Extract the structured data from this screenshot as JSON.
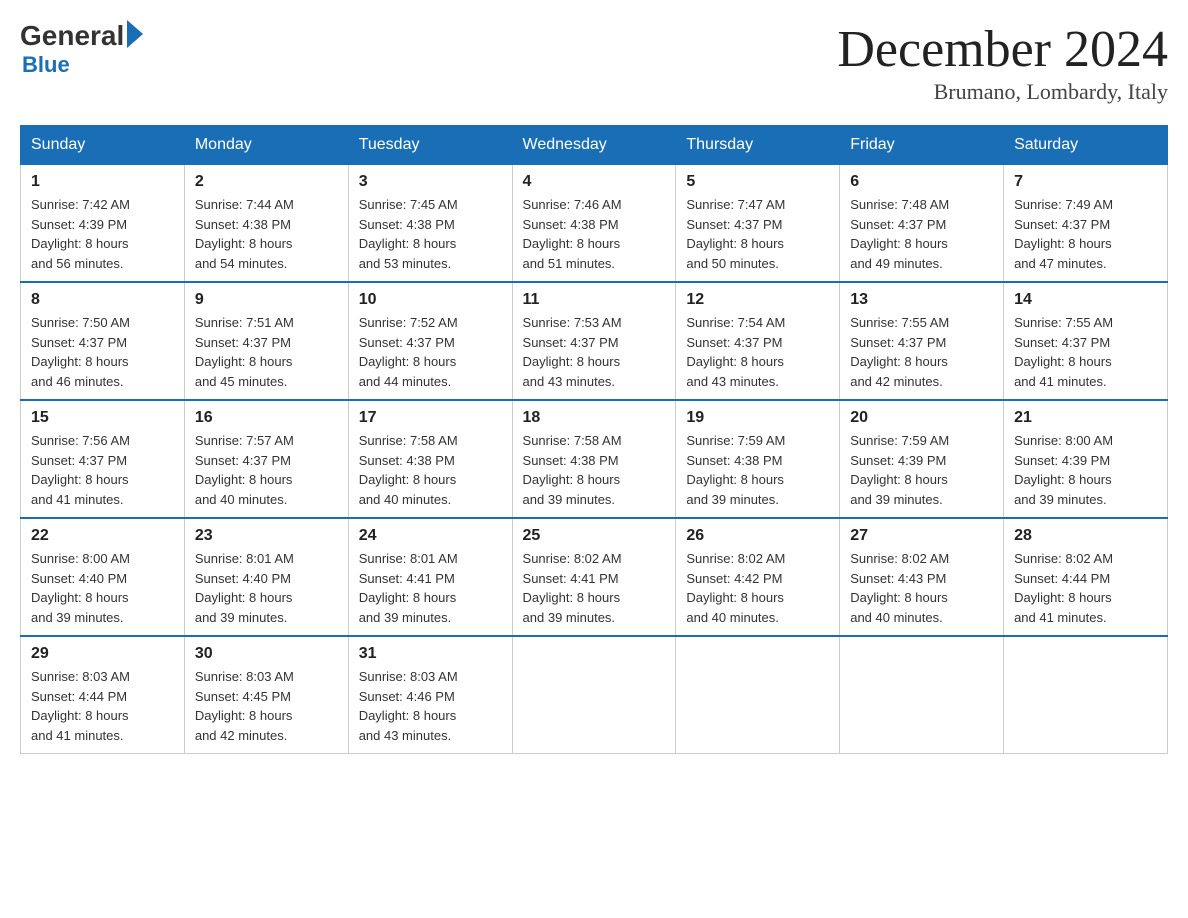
{
  "logo": {
    "general": "General",
    "blue": "Blue"
  },
  "header": {
    "month": "December 2024",
    "location": "Brumano, Lombardy, Italy"
  },
  "weekdays": [
    "Sunday",
    "Monday",
    "Tuesday",
    "Wednesday",
    "Thursday",
    "Friday",
    "Saturday"
  ],
  "weeks": [
    [
      {
        "day": "1",
        "sunrise": "7:42 AM",
        "sunset": "4:39 PM",
        "daylight": "8 hours and 56 minutes."
      },
      {
        "day": "2",
        "sunrise": "7:44 AM",
        "sunset": "4:38 PM",
        "daylight": "8 hours and 54 minutes."
      },
      {
        "day": "3",
        "sunrise": "7:45 AM",
        "sunset": "4:38 PM",
        "daylight": "8 hours and 53 minutes."
      },
      {
        "day": "4",
        "sunrise": "7:46 AM",
        "sunset": "4:38 PM",
        "daylight": "8 hours and 51 minutes."
      },
      {
        "day": "5",
        "sunrise": "7:47 AM",
        "sunset": "4:37 PM",
        "daylight": "8 hours and 50 minutes."
      },
      {
        "day": "6",
        "sunrise": "7:48 AM",
        "sunset": "4:37 PM",
        "daylight": "8 hours and 49 minutes."
      },
      {
        "day": "7",
        "sunrise": "7:49 AM",
        "sunset": "4:37 PM",
        "daylight": "8 hours and 47 minutes."
      }
    ],
    [
      {
        "day": "8",
        "sunrise": "7:50 AM",
        "sunset": "4:37 PM",
        "daylight": "8 hours and 46 minutes."
      },
      {
        "day": "9",
        "sunrise": "7:51 AM",
        "sunset": "4:37 PM",
        "daylight": "8 hours and 45 minutes."
      },
      {
        "day": "10",
        "sunrise": "7:52 AM",
        "sunset": "4:37 PM",
        "daylight": "8 hours and 44 minutes."
      },
      {
        "day": "11",
        "sunrise": "7:53 AM",
        "sunset": "4:37 PM",
        "daylight": "8 hours and 43 minutes."
      },
      {
        "day": "12",
        "sunrise": "7:54 AM",
        "sunset": "4:37 PM",
        "daylight": "8 hours and 43 minutes."
      },
      {
        "day": "13",
        "sunrise": "7:55 AM",
        "sunset": "4:37 PM",
        "daylight": "8 hours and 42 minutes."
      },
      {
        "day": "14",
        "sunrise": "7:55 AM",
        "sunset": "4:37 PM",
        "daylight": "8 hours and 41 minutes."
      }
    ],
    [
      {
        "day": "15",
        "sunrise": "7:56 AM",
        "sunset": "4:37 PM",
        "daylight": "8 hours and 41 minutes."
      },
      {
        "day": "16",
        "sunrise": "7:57 AM",
        "sunset": "4:37 PM",
        "daylight": "8 hours and 40 minutes."
      },
      {
        "day": "17",
        "sunrise": "7:58 AM",
        "sunset": "4:38 PM",
        "daylight": "8 hours and 40 minutes."
      },
      {
        "day": "18",
        "sunrise": "7:58 AM",
        "sunset": "4:38 PM",
        "daylight": "8 hours and 39 minutes."
      },
      {
        "day": "19",
        "sunrise": "7:59 AM",
        "sunset": "4:38 PM",
        "daylight": "8 hours and 39 minutes."
      },
      {
        "day": "20",
        "sunrise": "7:59 AM",
        "sunset": "4:39 PM",
        "daylight": "8 hours and 39 minutes."
      },
      {
        "day": "21",
        "sunrise": "8:00 AM",
        "sunset": "4:39 PM",
        "daylight": "8 hours and 39 minutes."
      }
    ],
    [
      {
        "day": "22",
        "sunrise": "8:00 AM",
        "sunset": "4:40 PM",
        "daylight": "8 hours and 39 minutes."
      },
      {
        "day": "23",
        "sunrise": "8:01 AM",
        "sunset": "4:40 PM",
        "daylight": "8 hours and 39 minutes."
      },
      {
        "day": "24",
        "sunrise": "8:01 AM",
        "sunset": "4:41 PM",
        "daylight": "8 hours and 39 minutes."
      },
      {
        "day": "25",
        "sunrise": "8:02 AM",
        "sunset": "4:41 PM",
        "daylight": "8 hours and 39 minutes."
      },
      {
        "day": "26",
        "sunrise": "8:02 AM",
        "sunset": "4:42 PM",
        "daylight": "8 hours and 40 minutes."
      },
      {
        "day": "27",
        "sunrise": "8:02 AM",
        "sunset": "4:43 PM",
        "daylight": "8 hours and 40 minutes."
      },
      {
        "day": "28",
        "sunrise": "8:02 AM",
        "sunset": "4:44 PM",
        "daylight": "8 hours and 41 minutes."
      }
    ],
    [
      {
        "day": "29",
        "sunrise": "8:03 AM",
        "sunset": "4:44 PM",
        "daylight": "8 hours and 41 minutes."
      },
      {
        "day": "30",
        "sunrise": "8:03 AM",
        "sunset": "4:45 PM",
        "daylight": "8 hours and 42 minutes."
      },
      {
        "day": "31",
        "sunrise": "8:03 AM",
        "sunset": "4:46 PM",
        "daylight": "8 hours and 43 minutes."
      },
      null,
      null,
      null,
      null
    ]
  ],
  "labels": {
    "sunrise": "Sunrise:",
    "sunset": "Sunset:",
    "daylight": "Daylight:"
  }
}
